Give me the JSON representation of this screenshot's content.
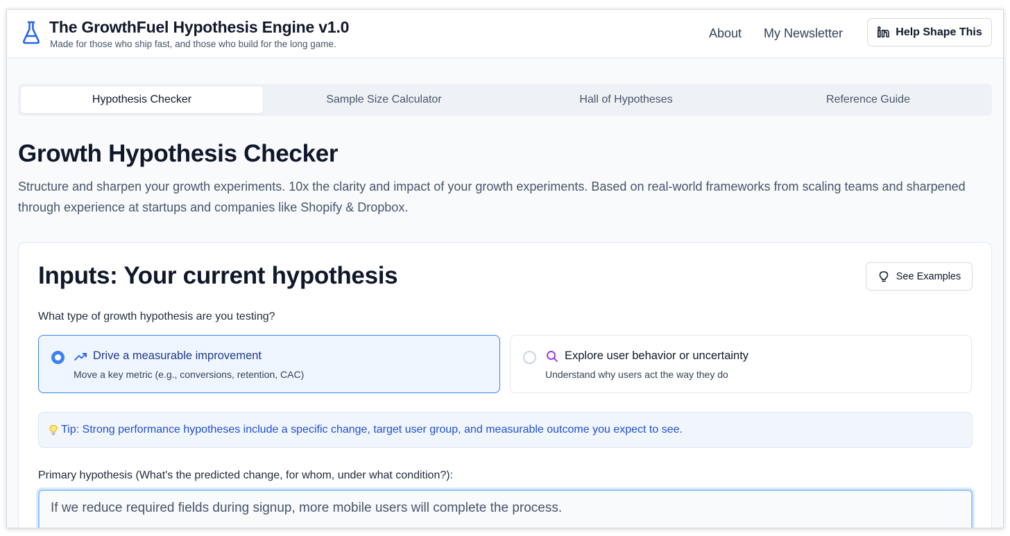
{
  "header": {
    "title": "The GrowthFuel Hypothesis Engine v1.0",
    "subtitle": "Made for those who ship fast, and those who build for the long game.",
    "logo_icon": "flask-icon",
    "nav": {
      "about": "About",
      "newsletter": "My Newsletter",
      "help_button": "Help Shape This",
      "help_icon": "linkedin-icon"
    }
  },
  "tabs": [
    {
      "label": "Hypothesis Checker",
      "active": true
    },
    {
      "label": "Sample Size Calculator",
      "active": false
    },
    {
      "label": "Hall of Hypotheses",
      "active": false
    },
    {
      "label": "Reference Guide",
      "active": false
    }
  ],
  "page": {
    "title": "Growth Hypothesis Checker",
    "description": "Structure and sharpen your growth experiments. 10x the clarity and impact of your growth experiments. Based on real-world frameworks from scaling teams and sharpened through experience at startups and companies like Shopify & Dropbox."
  },
  "card": {
    "title": "Inputs: Your current hypothesis",
    "examples_button": "See Examples",
    "examples_icon": "lightbulb-icon",
    "type_question": "What type of growth hypothesis are you testing?",
    "options": [
      {
        "title": "Drive a measurable improvement",
        "description": "Move a key metric (e.g., conversions, retention, CAC)",
        "icon": "trending-up-icon",
        "selected": true
      },
      {
        "title": "Explore user behavior or uncertainty",
        "description": "Understand why users act the way they do",
        "icon": "search-icon",
        "selected": false
      }
    ],
    "tip": "Tip: Strong performance hypotheses include a specific change, target user group, and measurable outcome you expect to see.",
    "primary_label": "Primary hypothesis (What's the predicted change, for whom, under what condition?):",
    "primary_value": "If we reduce required fields during signup, more mobile users will complete the process."
  },
  "colors": {
    "accent": "#3b82f6",
    "tip_text": "#1d4ed8",
    "explore_icon": "#9333ea"
  }
}
